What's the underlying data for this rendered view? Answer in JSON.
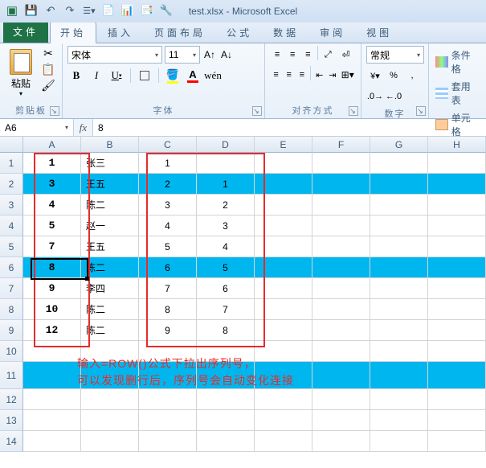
{
  "title": "test.xlsx - Microsoft Excel",
  "qat": {
    "save": "💾",
    "undo": "↶",
    "redo": "↷"
  },
  "tabs": [
    "文件",
    "开始",
    "插入",
    "页面布局",
    "公式",
    "数据",
    "审阅",
    "视图"
  ],
  "ribbon": {
    "clipboard": {
      "paste": "粘贴",
      "label": "剪贴板"
    },
    "font": {
      "name": "宋体",
      "size": "11",
      "label": "字体"
    },
    "align": {
      "label": "对齐方式"
    },
    "number": {
      "format": "常规",
      "label": "数字"
    },
    "styles": {
      "cond": "条件格",
      "table": "套用表",
      "cell": "单元格"
    }
  },
  "namebox": "A6",
  "formula": "8",
  "cols": [
    "A",
    "B",
    "C",
    "D",
    "E",
    "F",
    "G",
    "H"
  ],
  "rows": [
    {
      "n": "1",
      "hl": false,
      "a": "1",
      "b": "张三",
      "c": "1",
      "d": ""
    },
    {
      "n": "2",
      "hl": true,
      "a": "3",
      "b": "王五",
      "c": "2",
      "d": "1"
    },
    {
      "n": "3",
      "hl": false,
      "a": "4",
      "b": "陈二",
      "c": "3",
      "d": "2"
    },
    {
      "n": "4",
      "hl": false,
      "a": "5",
      "b": "赵一",
      "c": "4",
      "d": "3"
    },
    {
      "n": "5",
      "hl": false,
      "a": "7",
      "b": "王五",
      "c": "5",
      "d": "4"
    },
    {
      "n": "6",
      "hl": true,
      "a": "8",
      "b": "陈二",
      "c": "6",
      "d": "5"
    },
    {
      "n": "7",
      "hl": false,
      "a": "9",
      "b": "李四",
      "c": "7",
      "d": "6"
    },
    {
      "n": "8",
      "hl": false,
      "a": "10",
      "b": "陈二",
      "c": "8",
      "d": "7"
    },
    {
      "n": "9",
      "hl": false,
      "a": "12",
      "b": "陈二",
      "c": "9",
      "d": "8"
    },
    {
      "n": "10",
      "hl": false,
      "a": "",
      "b": "",
      "c": "",
      "d": ""
    },
    {
      "n": "11",
      "hl": true,
      "a": "",
      "b": "",
      "c": "",
      "d": ""
    },
    {
      "n": "12",
      "hl": false,
      "a": "",
      "b": "",
      "c": "",
      "d": ""
    },
    {
      "n": "13",
      "hl": false,
      "a": "",
      "b": "",
      "c": "",
      "d": ""
    },
    {
      "n": "14",
      "hl": false,
      "a": "",
      "b": "",
      "c": "",
      "d": ""
    }
  ],
  "annotation": {
    "line1": "输入=ROW()公式下拉出序列号，",
    "line2": "可以发现删行后，序列号会自动变化连接"
  }
}
